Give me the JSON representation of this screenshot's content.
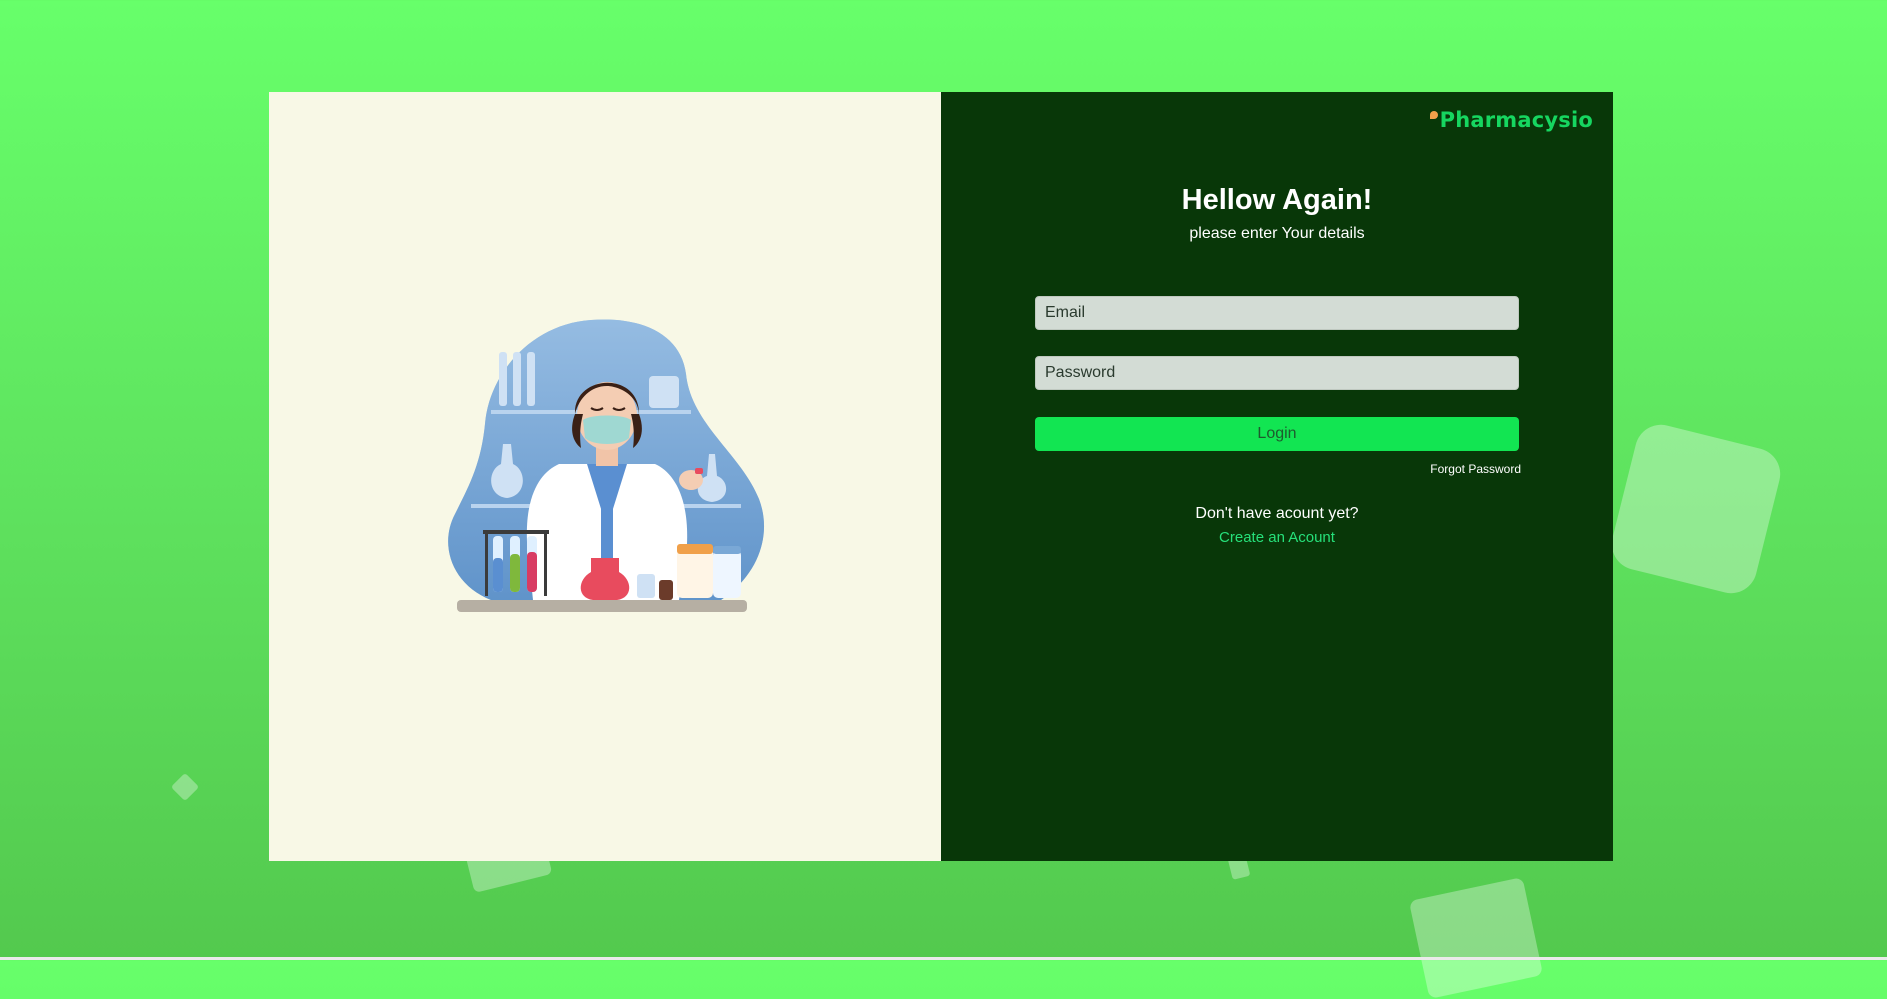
{
  "brand": {
    "name": "Pharmacysio"
  },
  "login": {
    "title": "Hellow Again!",
    "subtitle": "please enter Your details",
    "email_placeholder": "Email",
    "password_placeholder": "Password",
    "login_label": "Login",
    "forgot_label": "Forgot Password",
    "no_account_text": "Don't have acount yet?",
    "create_account_label": "Create an Acount"
  },
  "illustration": {
    "icon": "pharmacist-illustration"
  },
  "colors": {
    "background": "#67ff6a",
    "left_panel": "#f8f8e6",
    "right_panel": "#083708",
    "button": "#12e552",
    "link": "#26e07a",
    "brand": "#16d660"
  }
}
